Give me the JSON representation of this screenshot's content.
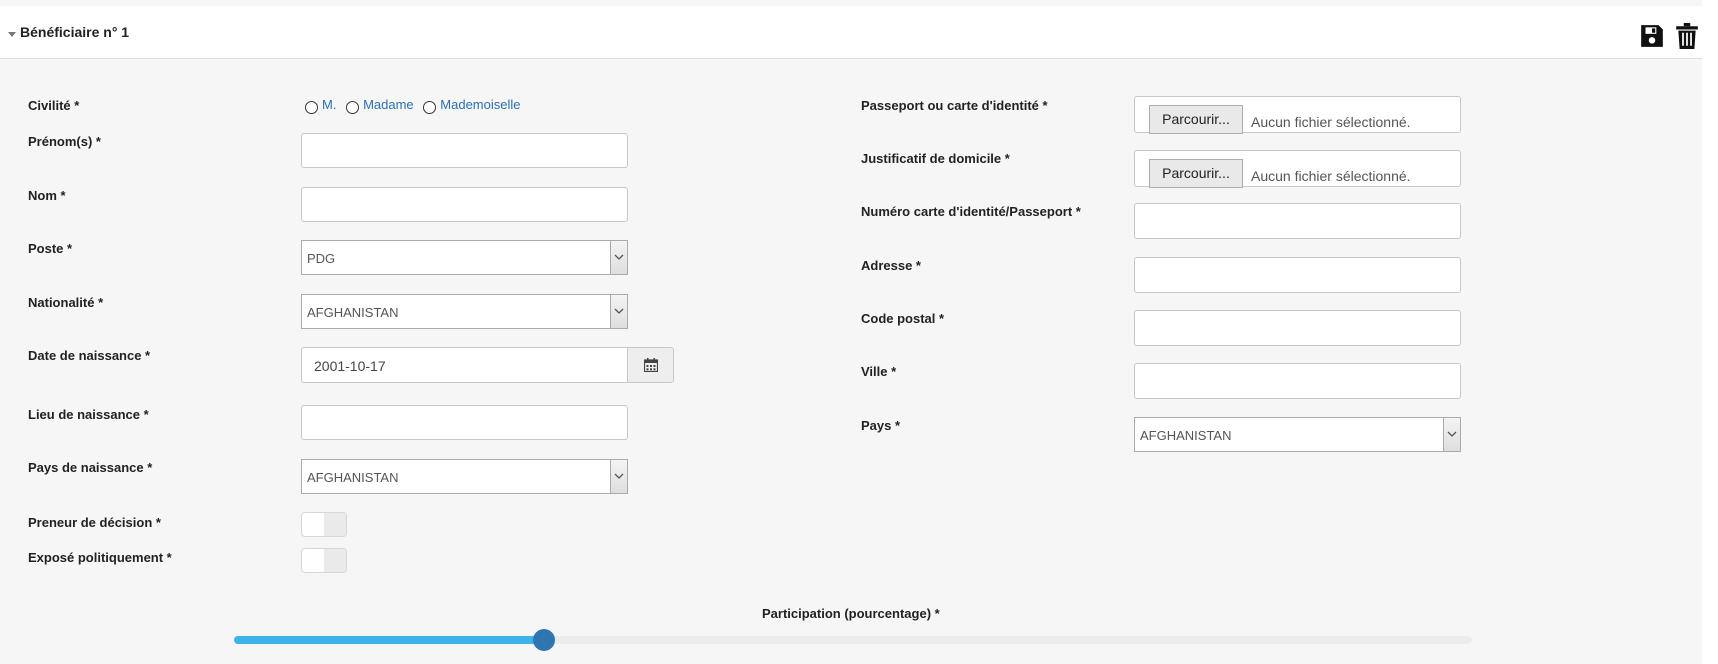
{
  "header": {
    "title": "Bénéficiaire n° 1",
    "save_icon": "save-icon",
    "delete_icon": "trash-icon"
  },
  "left": {
    "civilite": {
      "label": "Civilité *",
      "options": [
        "M.",
        "Madame",
        "Mademoiselle"
      ]
    },
    "prenom": {
      "label": "Prénom(s) *",
      "value": ""
    },
    "nom": {
      "label": "Nom *",
      "value": ""
    },
    "poste": {
      "label": "Poste *",
      "value": "PDG"
    },
    "nationalite": {
      "label": "Nationalité *",
      "value": "AFGHANISTAN"
    },
    "date_naissance": {
      "label": "Date de naissance *",
      "value": "2001-10-17",
      "icon": "calendar-icon"
    },
    "lieu_naissance": {
      "label": "Lieu de naissance *",
      "value": ""
    },
    "pays_naissance": {
      "label": "Pays de naissance *",
      "value": "AFGHANISTAN"
    },
    "preneur_decision": {
      "label": "Preneur de décision *",
      "checked": false
    },
    "expose_politiquement": {
      "label": "Exposé politiquement *",
      "checked": false
    }
  },
  "right": {
    "passeport": {
      "label": "Passeport ou carte d'identité *",
      "button": "Parcourir...",
      "status": "Aucun fichier sélectionné."
    },
    "justificatif": {
      "label": "Justificatif de domicile *",
      "button": "Parcourir...",
      "status": "Aucun fichier sélectionné."
    },
    "numero_carte": {
      "label": "Numéro carte d'identité/Passeport *",
      "value": ""
    },
    "adresse": {
      "label": "Adresse *",
      "value": ""
    },
    "code_postal": {
      "label": "Code postal *",
      "value": ""
    },
    "ville": {
      "label": "Ville *",
      "value": ""
    },
    "pays": {
      "label": "Pays *",
      "value": "AFGHANISTAN"
    }
  },
  "participation": {
    "label": "Participation (pourcentage) *",
    "value_fraction": 0.25
  },
  "colors": {
    "slider_fill": "#3cb4e5",
    "slider_thumb": "#2f76b1",
    "link": "#2c6fb0"
  }
}
